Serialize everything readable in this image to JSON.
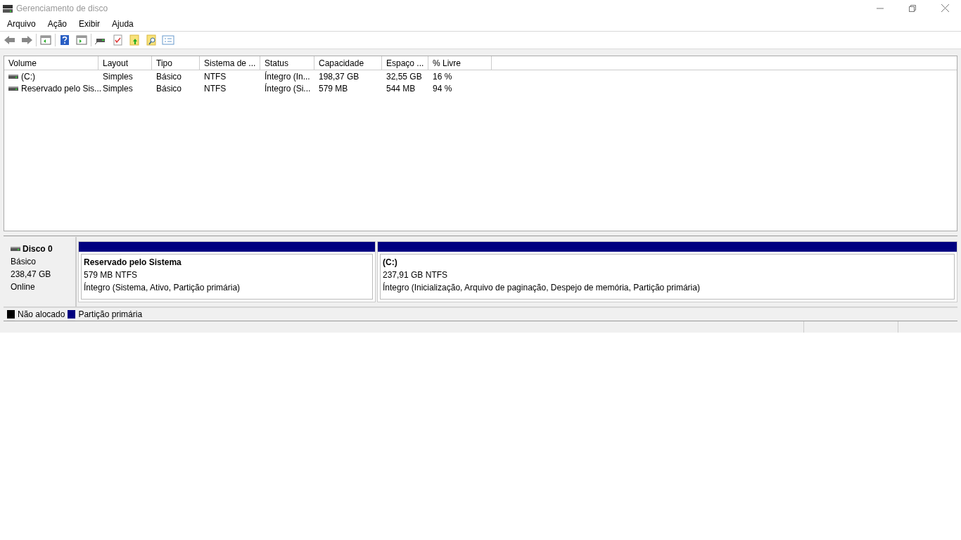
{
  "window": {
    "title": "Gerenciamento de disco"
  },
  "menu": [
    "Arquivo",
    "Ação",
    "Exibir",
    "Ajuda"
  ],
  "table": {
    "columns": [
      "Volume",
      "Layout",
      "Tipo",
      "Sistema de ...",
      "Status",
      "Capacidade",
      "Espaço ...",
      "% Livre"
    ],
    "rows": [
      [
        "(C:)",
        "Simples",
        "Básico",
        "NTFS",
        "Íntegro (In...",
        "198,37 GB",
        "32,55 GB",
        "16 %"
      ],
      [
        "Reservado pelo Sis...",
        "Simples",
        "Básico",
        "NTFS",
        "Íntegro (Si...",
        "579 MB",
        "544 MB",
        "94 %"
      ]
    ]
  },
  "disk": {
    "name": "Disco 0",
    "type": "Básico",
    "size": "238,47 GB",
    "status": "Online",
    "partitions": [
      {
        "name": "Reservado pelo Sistema",
        "size": "579 MB NTFS",
        "status": "Íntegro (Sistema, Ativo, Partição primária)",
        "color": "#000080"
      },
      {
        "name": "(C:)",
        "size": "237,91 GB NTFS",
        "status": "Íntegro (Inicialização, Arquivo de paginação, Despejo de memória, Partição primária)",
        "color": "#000080"
      }
    ]
  },
  "legend": [
    {
      "label": "Não alocado",
      "color": "#000000"
    },
    {
      "label": "Partição primária",
      "color": "#000080"
    }
  ]
}
